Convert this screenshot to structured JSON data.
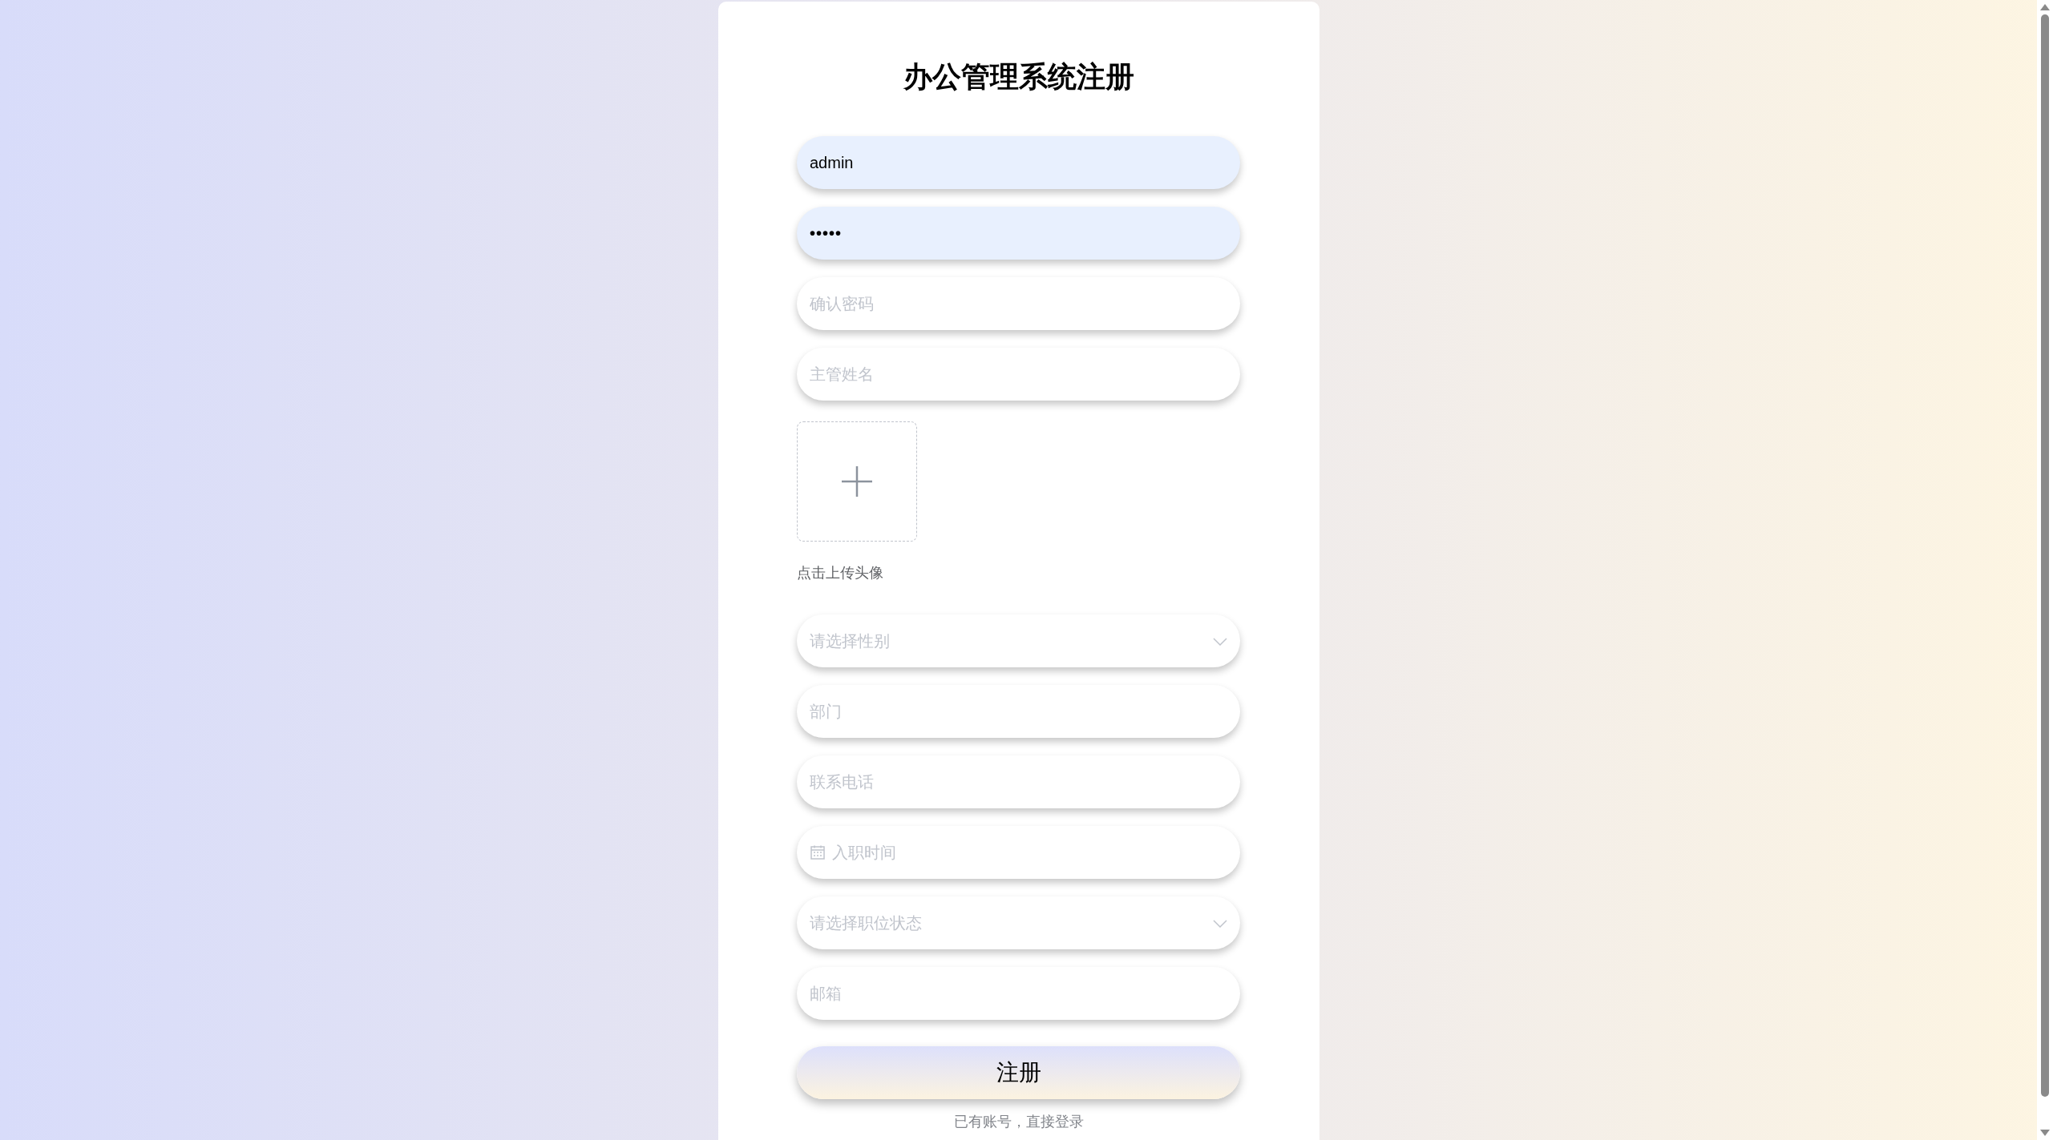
{
  "title": "办公管理系统注册",
  "fields_top": [
    {
      "kind": "text",
      "value": "admin"
    },
    {
      "kind": "password",
      "value": "•••••"
    },
    {
      "kind": "text",
      "placeholder": "确认密码"
    },
    {
      "kind": "text",
      "placeholder": "主管姓名"
    }
  ],
  "avatar_upload": {
    "label": "点击上传头像"
  },
  "fields_bottom": [
    {
      "kind": "select",
      "placeholder": "请选择性别"
    },
    {
      "kind": "text",
      "placeholder": "部门"
    },
    {
      "kind": "text",
      "placeholder": "联系电话"
    },
    {
      "kind": "date",
      "placeholder": "入职时间"
    },
    {
      "kind": "select",
      "placeholder": "请选择职位状态"
    },
    {
      "kind": "text",
      "placeholder": "邮箱"
    }
  ],
  "submit_button": "注册",
  "login_link": "已有账号，直接登录"
}
